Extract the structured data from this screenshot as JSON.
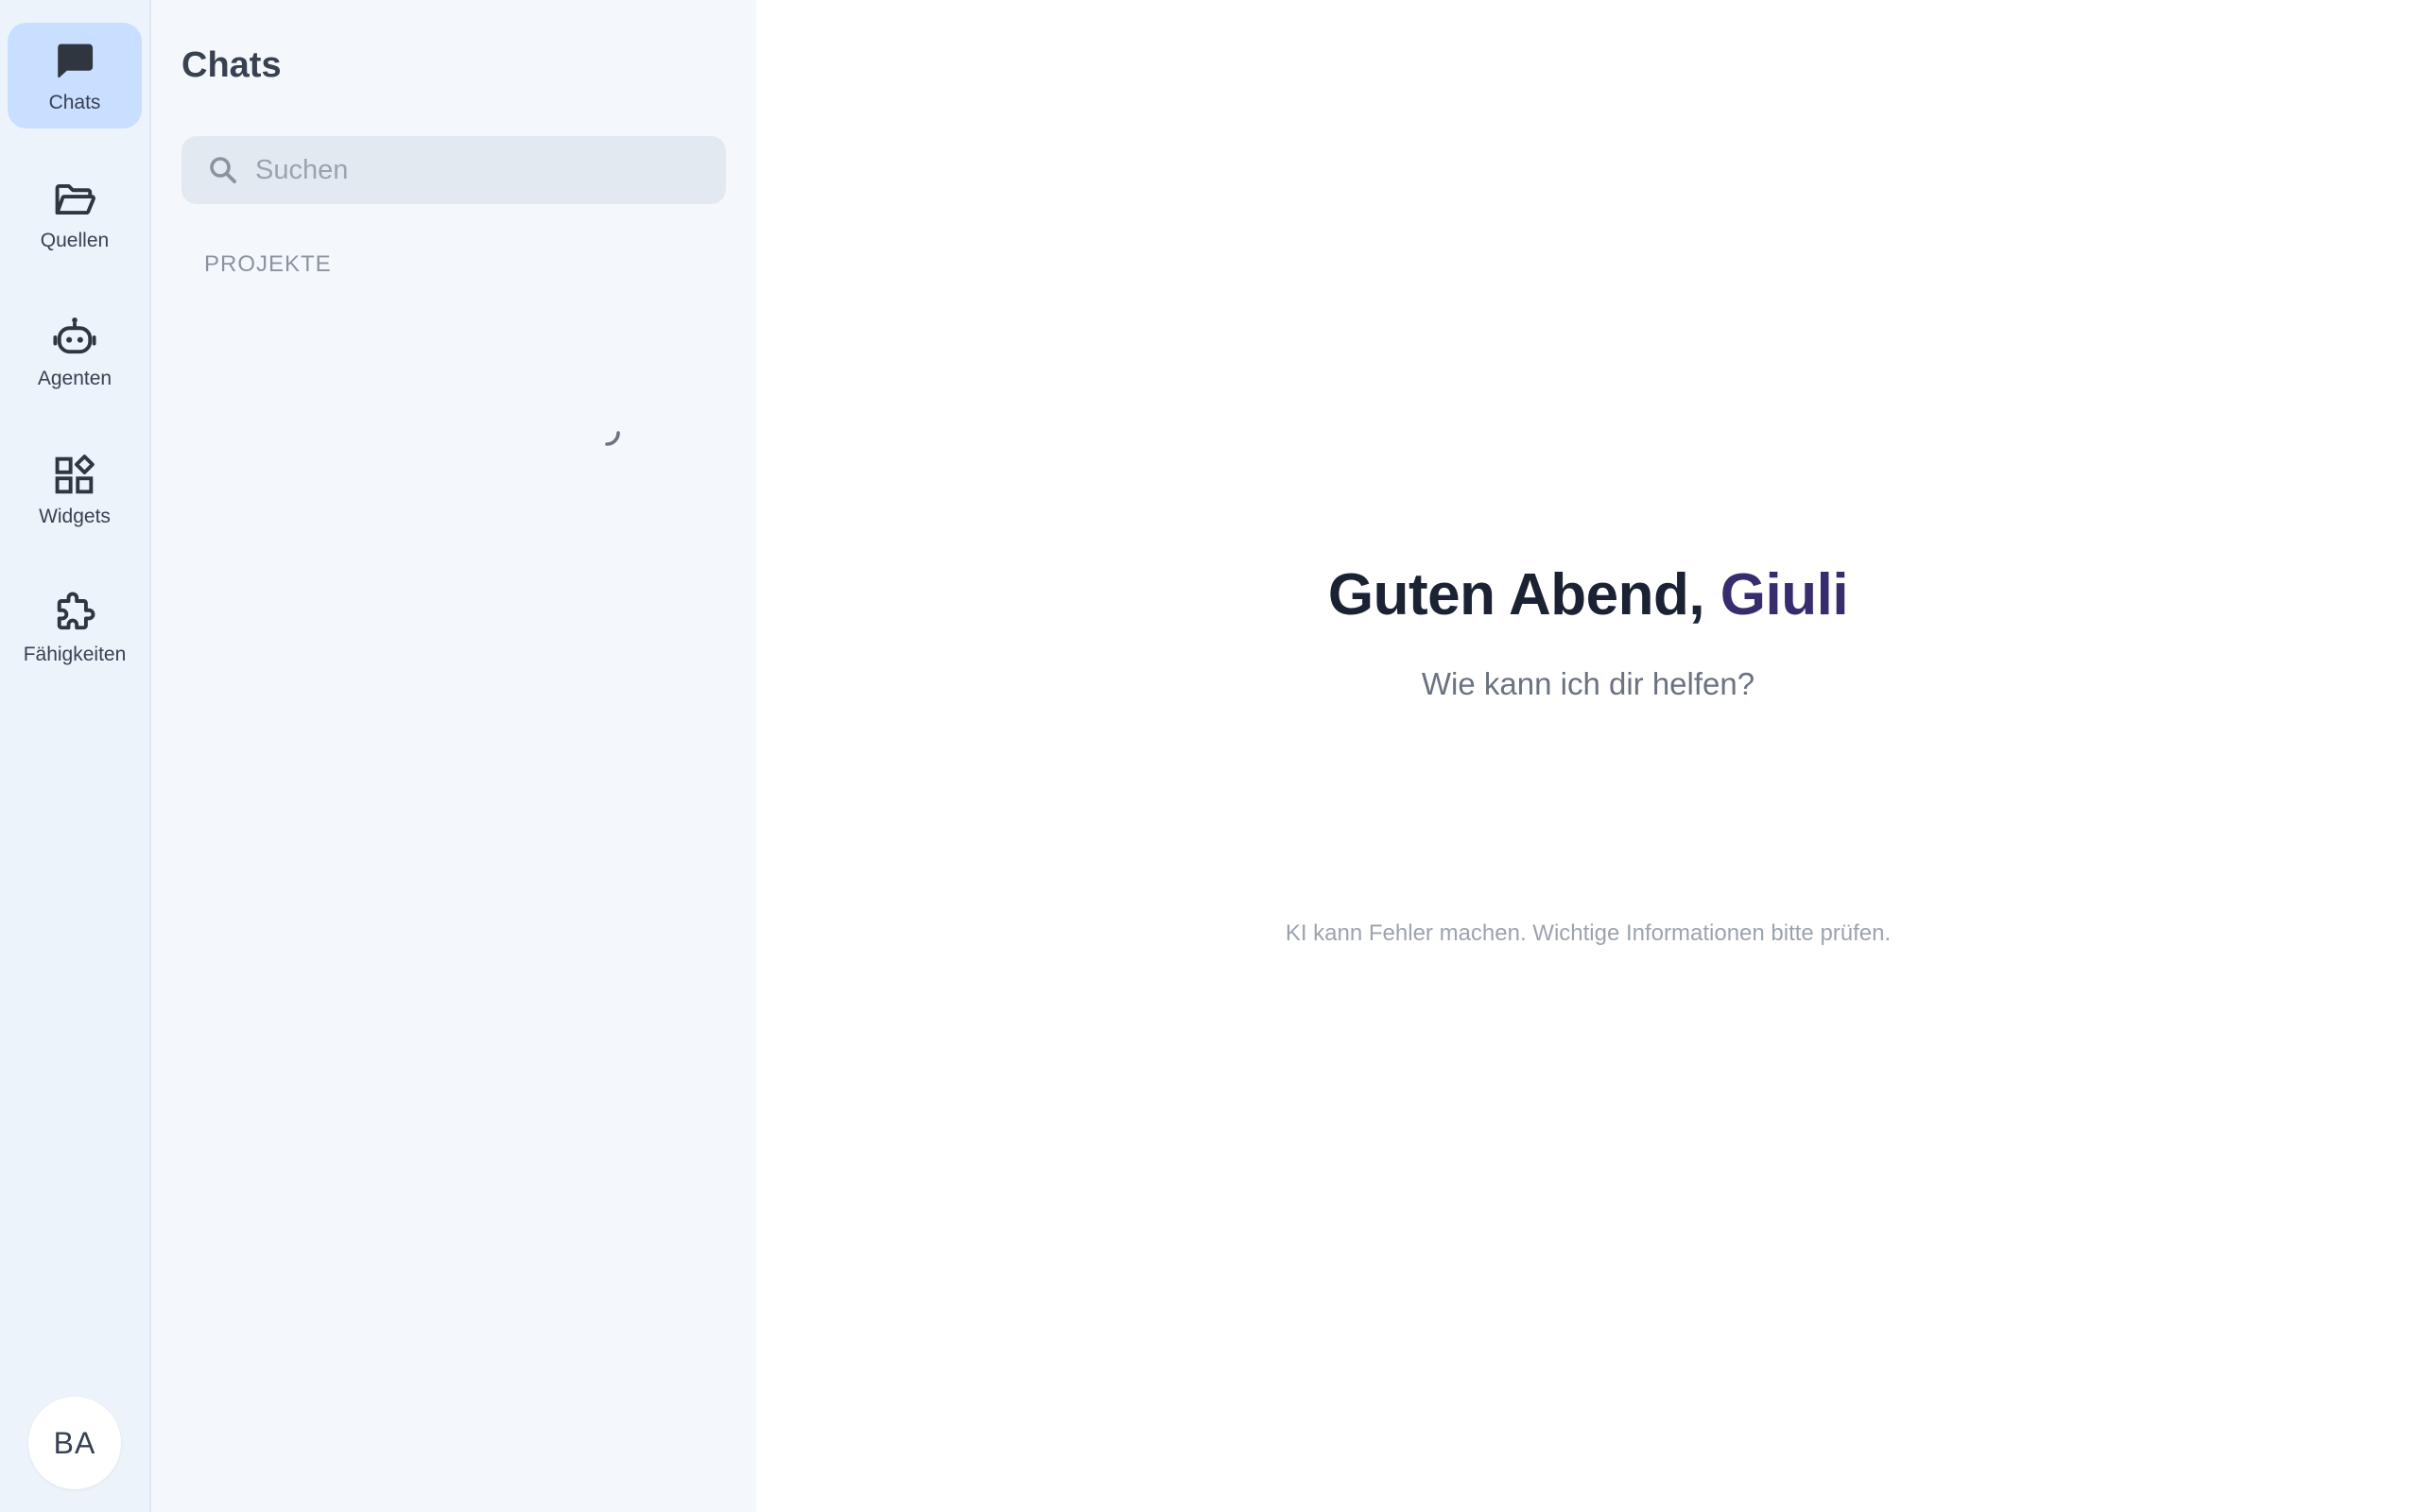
{
  "rail": {
    "items": [
      {
        "label": "Chats",
        "icon": "chat-bubble-icon",
        "active": true
      },
      {
        "label": "Quellen",
        "icon": "folder-open-icon"
      },
      {
        "label": "Agenten",
        "icon": "robot-icon"
      },
      {
        "label": "Widgets",
        "icon": "widgets-icon"
      },
      {
        "label": "Fähigkeiten",
        "icon": "puzzle-icon"
      }
    ],
    "avatar_initials": "BA"
  },
  "sidebar": {
    "title": "Chats",
    "archive_icon": "archive-icon",
    "new_chat_icon": "plus-icon",
    "search": {
      "placeholder": "Suchen",
      "value": ""
    },
    "projects_label": "PROJEKTE",
    "loading": true
  },
  "main": {
    "greeting_prefix": "Guten Abend, ",
    "greeting_name": "Giuli",
    "subtitle": "Wie kann ich dir helfen?",
    "disclaimer": "KI kann Fehler machen. Wichtige Informationen bitte prüfen."
  },
  "colors": {
    "rail_bg": "#edf3fb",
    "rail_active": "#c9dfff",
    "sidebar_bg": "#f4f8fd",
    "new_button": "#0d1016",
    "greeting_name": "#392c6e"
  }
}
